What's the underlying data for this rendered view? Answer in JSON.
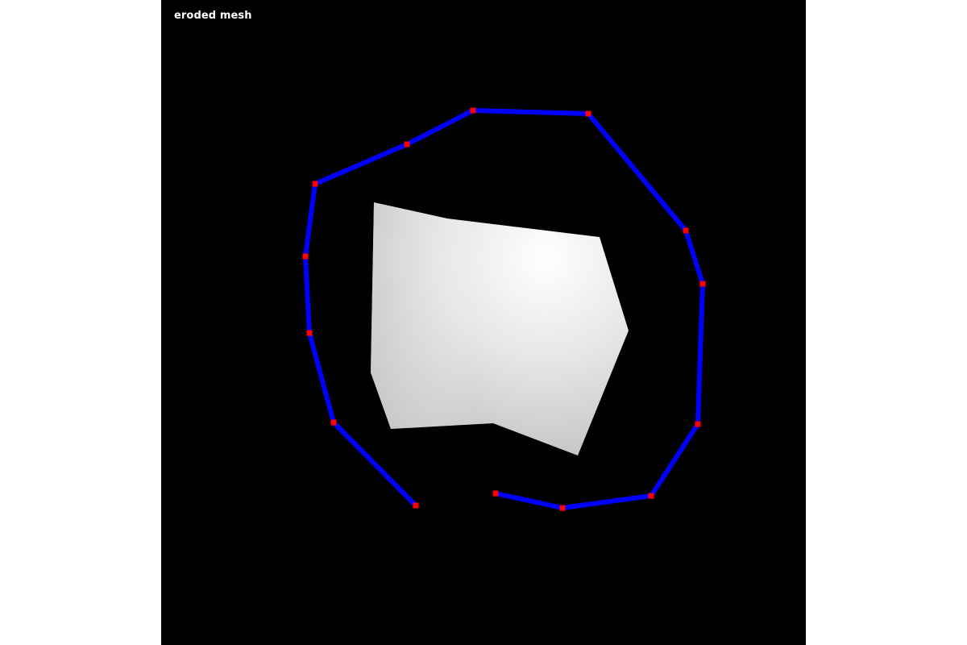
{
  "viewport": {
    "title": "eroded mesh",
    "background": "#000000"
  },
  "colors": {
    "polyline": "#0000ff",
    "vertex": "#ff0000",
    "mesh_light": "#ffffff",
    "mesh_dark": "#c0c0c0"
  }
}
